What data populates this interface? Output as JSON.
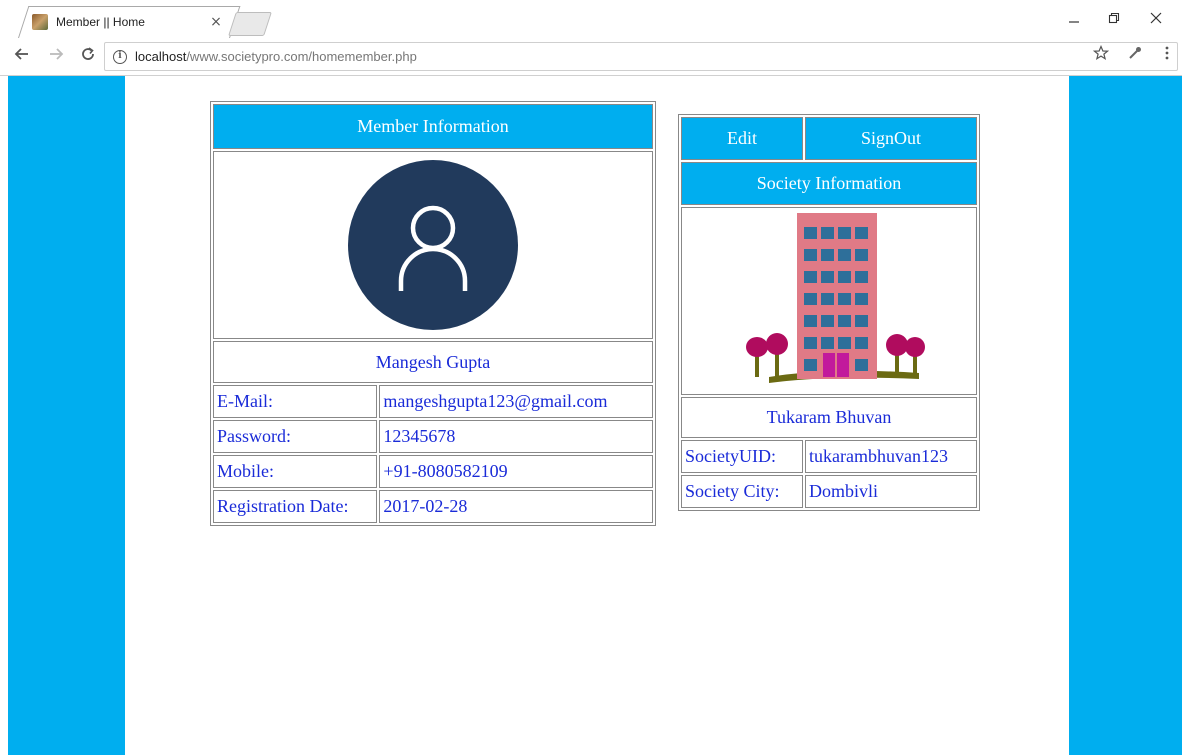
{
  "browser": {
    "tab_title": "Member || Home",
    "tab_close": "×",
    "url_host": "localhost",
    "url_path": "/www.societypro.com/homemember.php",
    "info_glyph": "i",
    "icons": [
      "back-icon",
      "forward-icon",
      "reload-icon",
      "info-icon",
      "star-icon",
      "extension-icon",
      "menu-icon"
    ]
  },
  "member": {
    "header": "Member Information",
    "name": "Mangesh Gupta",
    "fields": [
      {
        "label": "E-Mail:",
        "value": "mangeshgupta123@gmail.com"
      },
      {
        "label": "Password:",
        "value": "12345678"
      },
      {
        "label": "Mobile:",
        "value": "+91-8080582109"
      },
      {
        "label": "Registration Date:",
        "value": "2017-02-28"
      }
    ]
  },
  "society": {
    "edit_label": "Edit",
    "signout_label": "SignOut",
    "header": "Society Information",
    "name": "Tukaram Bhuvan",
    "fields": [
      {
        "label": "SocietyUID:",
        "value": "tukarambhuvan123"
      },
      {
        "label": "Society City:",
        "value": "Dombivli"
      }
    ]
  },
  "colors": {
    "accent": "#00aeef",
    "link_text": "#1a2bd8",
    "avatar_bg": "#213a5c",
    "building": "#e07a86",
    "window": "#2e6f9a"
  }
}
